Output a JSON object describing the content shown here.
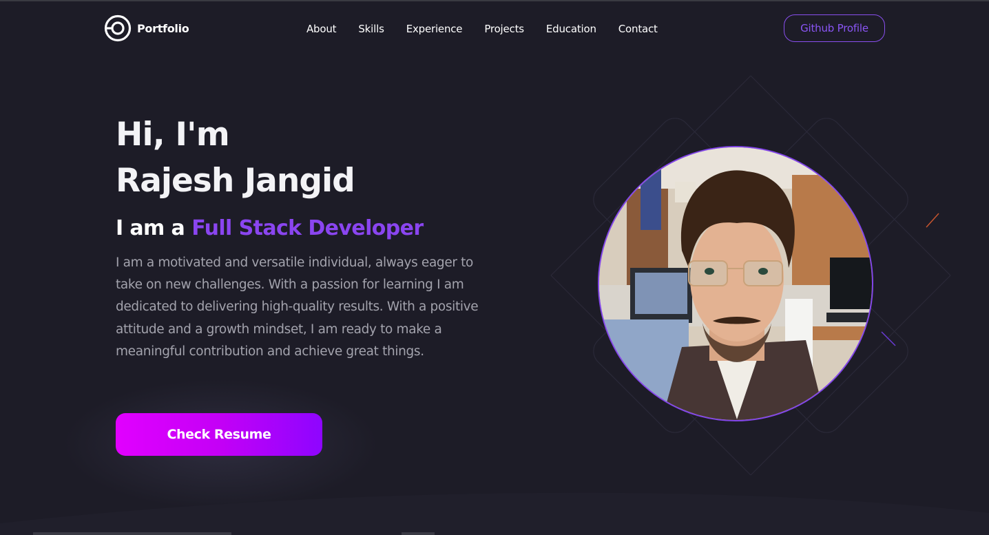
{
  "nav": {
    "logo_text": "Portfolio",
    "links": [
      "About",
      "Skills",
      "Experience",
      "Projects",
      "Education",
      "Contact"
    ],
    "github_label": "Github Profile"
  },
  "hero": {
    "greeting": "Hi, I'm",
    "name": "Rajesh Jangid",
    "role_prefix": "I am a",
    "role_title": "Full Stack Developer",
    "description": "I am a motivated and versatile individual, always eager to take on new challenges. With a passion for learning I am dedicated to delivering high-quality results. With a positive attitude and a growth mindset, I am ready to make a meaningful contribution and achieve great things.",
    "resume_button": "Check Resume"
  },
  "colors": {
    "background": "#1d1c27",
    "accent": "#8a45f0",
    "button_gradient_start": "#e100ff",
    "button_gradient_end": "#8e05ff",
    "text_muted": "#a3a3ad"
  },
  "icons": {
    "logo": "portfolio-logo-icon"
  }
}
